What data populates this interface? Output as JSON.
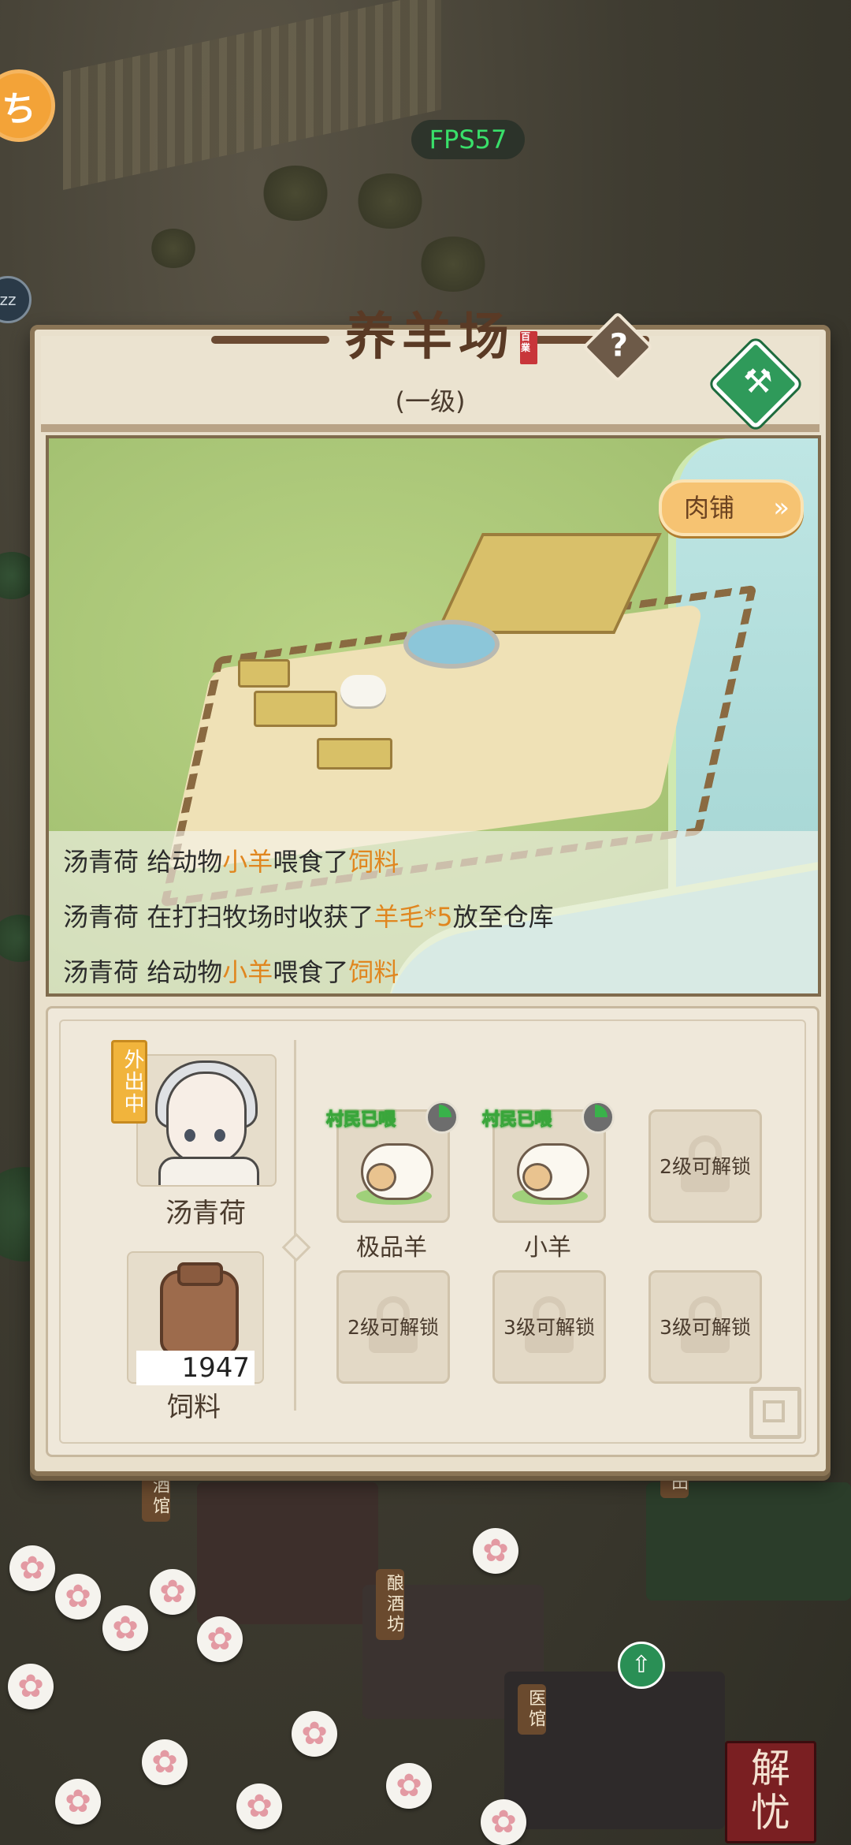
{
  "hud": {
    "fps": "FPS57",
    "side_icon_glyph": "ち",
    "side_icon2_text": "zz",
    "jieyou_line1": "解",
    "jieyou_line2": "忧"
  },
  "world_signs": {
    "tavern": "酒馆",
    "brewery": "酿酒坊",
    "clinic": "医馆",
    "field": "田"
  },
  "panel": {
    "title": "养羊场",
    "stamp": "百業",
    "level": "(一级)",
    "help_label": "?",
    "upgrade_icon": "⚒",
    "shop_button": "肉铺",
    "shop_arrows": "»",
    "log": [
      {
        "name": "汤青荷",
        "pre": " 给动物",
        "hl1": "小羊",
        "mid": "喂食了",
        "hl2": "饲料",
        "post": ""
      },
      {
        "name": "汤青荷",
        "pre": " 在打扫牧场时收获了",
        "hl1": "羊毛*5",
        "mid": "放至仓库",
        "hl2": "",
        "post": ""
      },
      {
        "name": "汤青荷",
        "pre": " 给动物",
        "hl1": "小羊",
        "mid": "喂食了",
        "hl2": "饲料",
        "post": ""
      }
    ],
    "keeper": {
      "status": "外出中",
      "name": "汤青荷"
    },
    "feed": {
      "count": "1947",
      "label": "饲料"
    },
    "animals": [
      {
        "fed": "村民已喂",
        "label": "极品羊"
      },
      {
        "fed": "村民已喂",
        "label": "小羊"
      }
    ],
    "locked": [
      {
        "text": "2级可解锁"
      },
      {
        "text": "2级可解锁"
      },
      {
        "text": "3级可解锁"
      },
      {
        "text": "3级可解锁"
      }
    ]
  }
}
